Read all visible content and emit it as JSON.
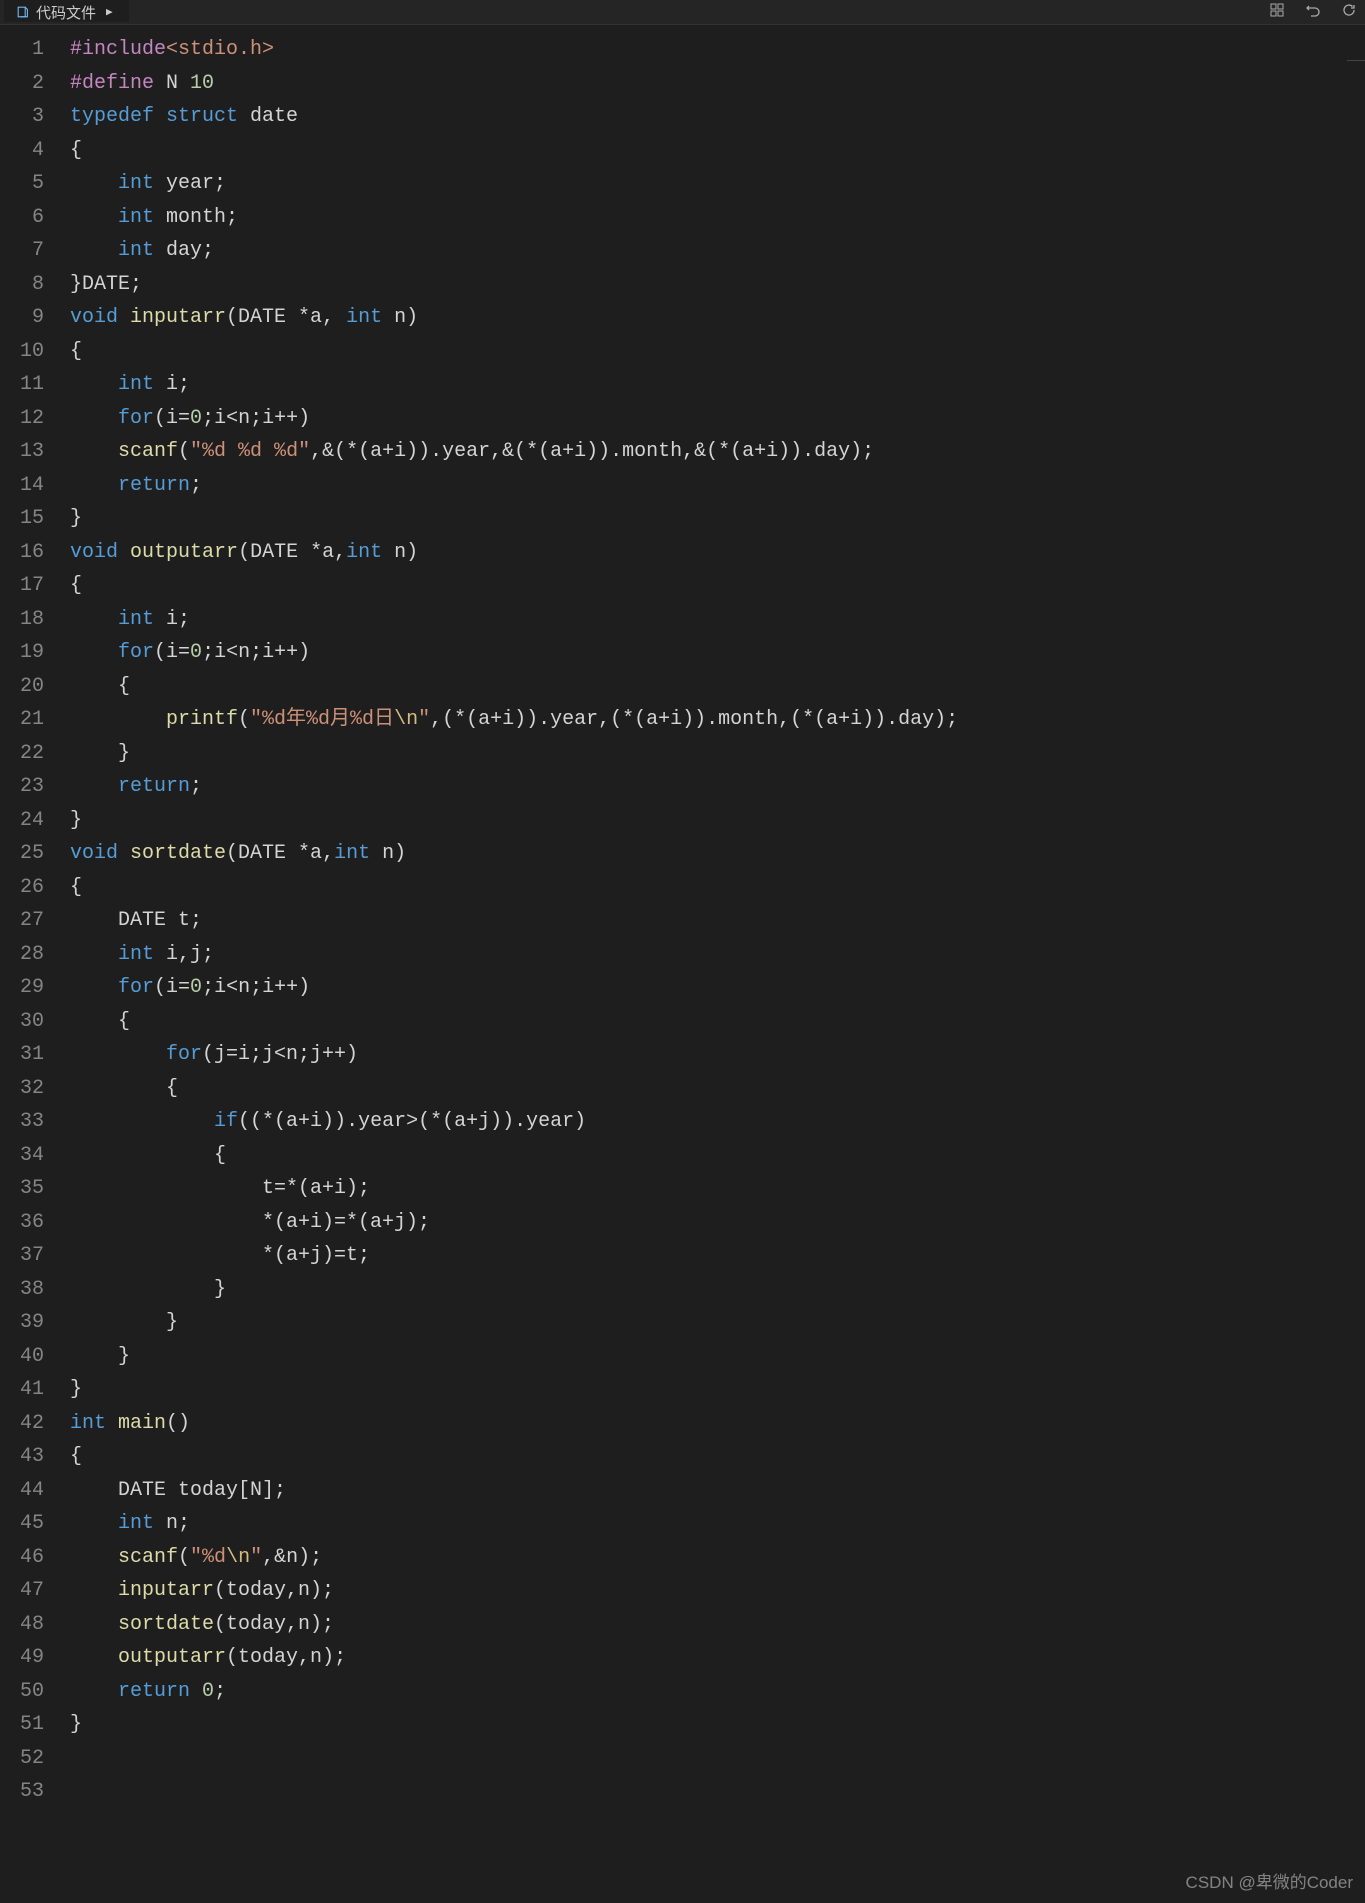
{
  "tab": {
    "label": "代码文件",
    "play_icon": "▶"
  },
  "toolbar_icons": [
    "grid-icon",
    "undo-icon",
    "refresh-icon"
  ],
  "watermark": "CSDN @卑微的Coder",
  "code": {
    "lines": [
      {
        "n": 1,
        "tokens": [
          [
            "c-include",
            "#include"
          ],
          [
            "c-header",
            "<stdio.h>"
          ]
        ]
      },
      {
        "n": 2,
        "tokens": [
          [
            "c-include",
            "#define"
          ],
          [
            "c-ident",
            " N "
          ],
          [
            "c-num",
            "10"
          ]
        ]
      },
      {
        "n": 3,
        "tokens": [
          [
            "c-keyword",
            "typedef"
          ],
          [
            "c-ident",
            " "
          ],
          [
            "c-keyword",
            "struct"
          ],
          [
            "c-ident",
            " date"
          ]
        ]
      },
      {
        "n": 4,
        "tokens": [
          [
            "c-punct",
            "{"
          ]
        ]
      },
      {
        "n": 5,
        "tokens": [
          [
            "c-ident",
            "    "
          ],
          [
            "c-type",
            "int"
          ],
          [
            "c-ident",
            " year;"
          ]
        ]
      },
      {
        "n": 6,
        "tokens": [
          [
            "c-ident",
            "    "
          ],
          [
            "c-type",
            "int"
          ],
          [
            "c-ident",
            " month;"
          ]
        ]
      },
      {
        "n": 7,
        "tokens": [
          [
            "c-ident",
            "    "
          ],
          [
            "c-type",
            "int"
          ],
          [
            "c-ident",
            " day;"
          ]
        ]
      },
      {
        "n": 8,
        "tokens": [
          [
            "c-punct",
            "}DATE;"
          ]
        ]
      },
      {
        "n": 9,
        "tokens": [
          [
            "c-type",
            "void"
          ],
          [
            "c-ident",
            " "
          ],
          [
            "c-func",
            "inputarr"
          ],
          [
            "c-punct",
            "(DATE *a, "
          ],
          [
            "c-type",
            "int"
          ],
          [
            "c-punct",
            " n)"
          ]
        ]
      },
      {
        "n": 10,
        "tokens": [
          [
            "c-punct",
            "{"
          ]
        ]
      },
      {
        "n": 11,
        "tokens": [
          [
            "c-ident",
            "    "
          ],
          [
            "c-type",
            "int"
          ],
          [
            "c-ident",
            " i;"
          ]
        ]
      },
      {
        "n": 12,
        "tokens": [
          [
            "c-ident",
            "    "
          ],
          [
            "c-keyword",
            "for"
          ],
          [
            "c-punct",
            "(i="
          ],
          [
            "c-num",
            "0"
          ],
          [
            "c-punct",
            ";i<n;i++)"
          ]
        ]
      },
      {
        "n": 13,
        "tokens": [
          [
            "c-ident",
            "    "
          ],
          [
            "c-func",
            "scanf"
          ],
          [
            "c-punct",
            "("
          ],
          [
            "c-str",
            "\"%d %d %d\""
          ],
          [
            "c-punct",
            ",&(*(a+i)).year,&(*(a+i)).month,&(*(a+i)).day);"
          ]
        ]
      },
      {
        "n": 14,
        "tokens": [
          [
            "c-ident",
            "    "
          ],
          [
            "c-keyword",
            "return"
          ],
          [
            "c-punct",
            ";"
          ]
        ]
      },
      {
        "n": 15,
        "tokens": [
          [
            "c-punct",
            "}"
          ]
        ]
      },
      {
        "n": 16,
        "tokens": [
          [
            "c-type",
            "void"
          ],
          [
            "c-ident",
            " "
          ],
          [
            "c-func",
            "outputarr"
          ],
          [
            "c-punct",
            "(DATE *a,"
          ],
          [
            "c-type",
            "int"
          ],
          [
            "c-punct",
            " n)"
          ]
        ]
      },
      {
        "n": 17,
        "tokens": [
          [
            "c-punct",
            "{"
          ]
        ]
      },
      {
        "n": 18,
        "tokens": [
          [
            "c-ident",
            "    "
          ],
          [
            "c-type",
            "int"
          ],
          [
            "c-ident",
            " i;"
          ]
        ]
      },
      {
        "n": 19,
        "tokens": [
          [
            "c-ident",
            "    "
          ],
          [
            "c-keyword",
            "for"
          ],
          [
            "c-punct",
            "(i="
          ],
          [
            "c-num",
            "0"
          ],
          [
            "c-punct",
            ";i<n;i++)"
          ]
        ]
      },
      {
        "n": 20,
        "tokens": [
          [
            "c-ident",
            "    {"
          ]
        ]
      },
      {
        "n": 21,
        "tokens": [
          [
            "c-ident",
            "        "
          ],
          [
            "c-func",
            "printf"
          ],
          [
            "c-punct",
            "("
          ],
          [
            "c-str",
            "\"%d年%d月%d日"
          ],
          [
            "c-escape",
            "\\n"
          ],
          [
            "c-str",
            "\""
          ],
          [
            "c-punct",
            ",(*(a+i)).year,(*(a+i)).month,(*(a+i)).day);"
          ]
        ]
      },
      {
        "n": 22,
        "tokens": [
          [
            "c-ident",
            "    }"
          ]
        ]
      },
      {
        "n": 23,
        "tokens": [
          [
            "c-ident",
            "    "
          ],
          [
            "c-keyword",
            "return"
          ],
          [
            "c-punct",
            ";"
          ]
        ]
      },
      {
        "n": 24,
        "tokens": [
          [
            "c-punct",
            "}"
          ]
        ]
      },
      {
        "n": 25,
        "tokens": [
          [
            "c-type",
            "void"
          ],
          [
            "c-ident",
            " "
          ],
          [
            "c-func",
            "sortdate"
          ],
          [
            "c-punct",
            "(DATE *a,"
          ],
          [
            "c-type",
            "int"
          ],
          [
            "c-punct",
            " n)"
          ]
        ]
      },
      {
        "n": 26,
        "tokens": [
          [
            "c-punct",
            "{"
          ]
        ]
      },
      {
        "n": 27,
        "tokens": [
          [
            "c-ident",
            "    DATE t;"
          ]
        ]
      },
      {
        "n": 28,
        "tokens": [
          [
            "c-ident",
            "    "
          ],
          [
            "c-type",
            "int"
          ],
          [
            "c-ident",
            " i,j;"
          ]
        ]
      },
      {
        "n": 29,
        "tokens": [
          [
            "c-ident",
            "    "
          ],
          [
            "c-keyword",
            "for"
          ],
          [
            "c-punct",
            "(i="
          ],
          [
            "c-num",
            "0"
          ],
          [
            "c-punct",
            ";i<n;i++)"
          ]
        ]
      },
      {
        "n": 30,
        "tokens": [
          [
            "c-ident",
            "    {"
          ]
        ]
      },
      {
        "n": 31,
        "tokens": [
          [
            "c-ident",
            "        "
          ],
          [
            "c-keyword",
            "for"
          ],
          [
            "c-punct",
            "(j=i;j<n;j++)"
          ]
        ]
      },
      {
        "n": 32,
        "tokens": [
          [
            "c-ident",
            "        {"
          ]
        ]
      },
      {
        "n": 33,
        "tokens": [
          [
            "c-ident",
            "            "
          ],
          [
            "c-keyword",
            "if"
          ],
          [
            "c-punct",
            "((*(a+i)).year>(*(a+j)).year)"
          ]
        ]
      },
      {
        "n": 34,
        "tokens": [
          [
            "c-ident",
            "            {"
          ]
        ]
      },
      {
        "n": 35,
        "tokens": [
          [
            "c-ident",
            "                t=*(a+i);"
          ]
        ]
      },
      {
        "n": 36,
        "tokens": [
          [
            "c-ident",
            "                *(a+i)=*(a+j);"
          ]
        ]
      },
      {
        "n": 37,
        "tokens": [
          [
            "c-ident",
            "                *(a+j)=t;"
          ]
        ]
      },
      {
        "n": 38,
        "tokens": [
          [
            "c-ident",
            "            }"
          ]
        ]
      },
      {
        "n": 39,
        "tokens": [
          [
            "c-ident",
            "        }"
          ]
        ]
      },
      {
        "n": 40,
        "tokens": [
          [
            "c-ident",
            "    }"
          ]
        ]
      },
      {
        "n": 41,
        "tokens": [
          [
            "c-punct",
            "}"
          ]
        ]
      },
      {
        "n": 42,
        "tokens": [
          [
            "c-type",
            "int"
          ],
          [
            "c-ident",
            " "
          ],
          [
            "c-func",
            "main"
          ],
          [
            "c-punct",
            "()"
          ]
        ]
      },
      {
        "n": 43,
        "tokens": [
          [
            "c-punct",
            "{"
          ]
        ]
      },
      {
        "n": 44,
        "tokens": [
          [
            "c-ident",
            "    DATE today[N];"
          ]
        ]
      },
      {
        "n": 45,
        "tokens": [
          [
            "c-ident",
            "    "
          ],
          [
            "c-type",
            "int"
          ],
          [
            "c-ident",
            " n;"
          ]
        ]
      },
      {
        "n": 46,
        "tokens": [
          [
            "c-ident",
            "    "
          ],
          [
            "c-func",
            "scanf"
          ],
          [
            "c-punct",
            "("
          ],
          [
            "c-str",
            "\"%d"
          ],
          [
            "c-escape",
            "\\n"
          ],
          [
            "c-str",
            "\""
          ],
          [
            "c-punct",
            ",&n);"
          ]
        ]
      },
      {
        "n": 47,
        "tokens": [
          [
            "c-ident",
            "    "
          ],
          [
            "c-func",
            "inputarr"
          ],
          [
            "c-punct",
            "(today,n);"
          ]
        ]
      },
      {
        "n": 48,
        "tokens": [
          [
            "c-ident",
            "    "
          ],
          [
            "c-func",
            "sortdate"
          ],
          [
            "c-punct",
            "(today,n);"
          ]
        ]
      },
      {
        "n": 49,
        "tokens": [
          [
            "c-ident",
            "    "
          ],
          [
            "c-func",
            "outputarr"
          ],
          [
            "c-punct",
            "(today,n);"
          ]
        ]
      },
      {
        "n": 50,
        "tokens": [
          [
            "c-ident",
            "    "
          ],
          [
            "c-keyword",
            "return"
          ],
          [
            "c-ident",
            " "
          ],
          [
            "c-num",
            "0"
          ],
          [
            "c-punct",
            ";"
          ]
        ]
      },
      {
        "n": 51,
        "tokens": [
          [
            "c-punct",
            "}"
          ]
        ]
      },
      {
        "n": 52,
        "tokens": []
      },
      {
        "n": 53,
        "tokens": []
      }
    ]
  }
}
